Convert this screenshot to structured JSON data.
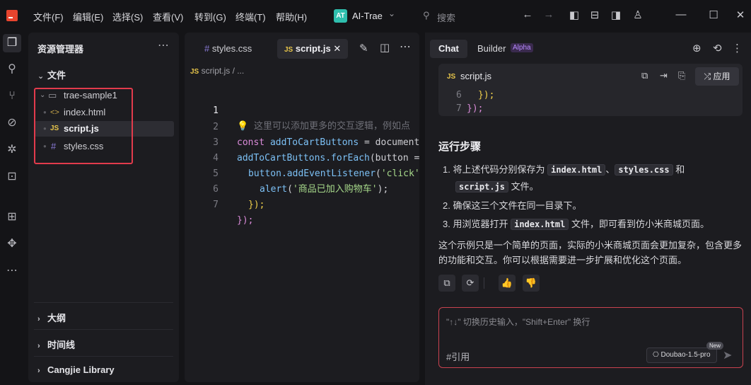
{
  "titlebar": {
    "menus": [
      "文件(F)",
      "编辑(E)",
      "选择(S)",
      "查看(V)",
      "转到(G)",
      "终端(T)",
      "帮助(H)"
    ],
    "ai_badge": "AT",
    "ai_name": "AI-Trae",
    "search_label": "搜索"
  },
  "explorer": {
    "title": "资源管理器",
    "section_files": "文件",
    "folder": "trae-sample1",
    "files": [
      {
        "name": "index.html",
        "icon": "html-icon"
      },
      {
        "name": "script.js",
        "icon": "js-icon"
      },
      {
        "name": "styles.css",
        "icon": "css-icon"
      }
    ],
    "section_outline": "大纲",
    "section_timeline": "时间线",
    "section_library": "Cangjie Library",
    "js_glyph": "JS",
    "css_glyph": "#",
    "html_glyph": "<>"
  },
  "editor": {
    "tabs": [
      {
        "label": "styles.css"
      },
      {
        "label": "script.js"
      }
    ],
    "breadcrumb_file": "script.js",
    "breadcrumb_sep": "/ ...",
    "lines": [
      {
        "n": "1",
        "comment": "这里可以添加更多的交互逻辑，例如点"
      },
      {
        "n": "2",
        "kw": "const",
        "var": "addToCartButtons",
        "rest": " = document"
      },
      {
        "n": "3",
        "var": "addToCartButtons",
        "fn": ".forEach",
        "rest": "(button ="
      },
      {
        "n": "4",
        "var": "button",
        "fn": ".addEventListener",
        "str": "'click'"
      },
      {
        "n": "5",
        "fn": "alert",
        "str": "'商品已加入购物车'",
        "rest": ");"
      },
      {
        "n": "6",
        "rest": "});"
      },
      {
        "n": "7",
        "rest": "});"
      }
    ]
  },
  "chat": {
    "tab_chat": "Chat",
    "tab_builder": "Builder",
    "alpha": "Alpha",
    "card_file": "script.js",
    "apply": "应用",
    "card_lines": [
      {
        "n": "6",
        "code": "});"
      },
      {
        "n": "7",
        "code": "});"
      }
    ],
    "heading": "运行步骤",
    "steps": {
      "s1_pre": "1. 将上述代码分别保存为",
      "s1_f1": "index.html",
      "s1_sep": "、",
      "s1_f2": "styles.css",
      "s1_and": "和",
      "s1_f3": "script.js",
      "s1_post": "文件。",
      "s2": "2. 确保这三个文件在同一目录下。",
      "s3_pre": "3. 用浏览器打开",
      "s3_f": "index.html",
      "s3_post": "文件，即可看到仿小米商城页面。"
    },
    "paragraph": "这个示例只是一个简单的页面，实际的小米商城页面会更加复杂，包含更多的功能和交互。你可以根据需要进一步扩展和优化这个页面。",
    "input_placeholder": "\"↑↓\" 切换历史输入，\"Shift+Enter\" 换行",
    "quote": "#引用",
    "model": "Doubao-1.5-pro",
    "new_badge": "New"
  }
}
